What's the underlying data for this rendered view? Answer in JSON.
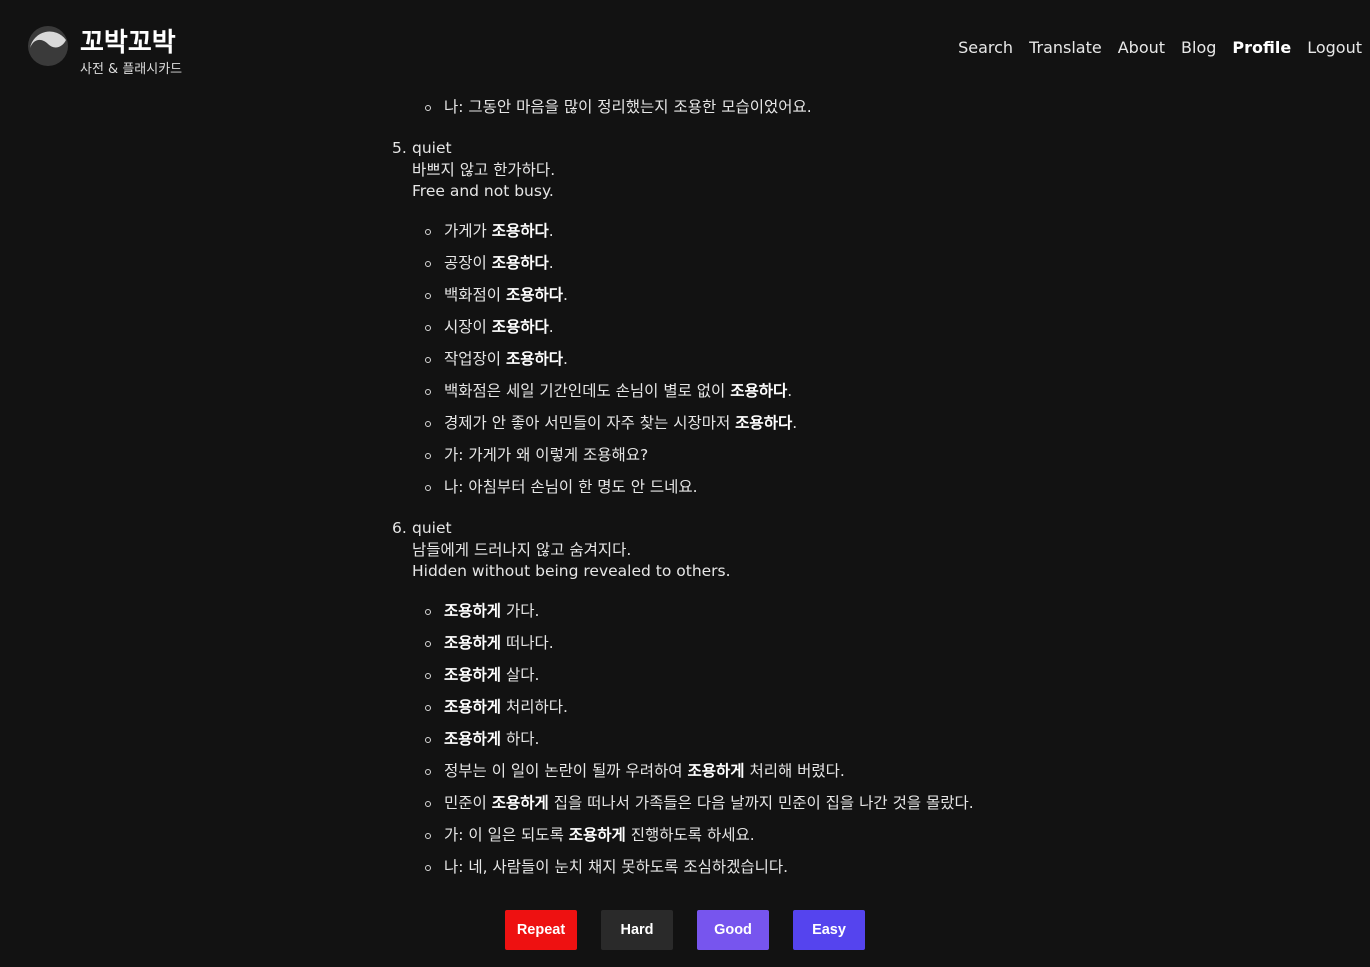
{
  "brand": {
    "title": "꼬박꼬박",
    "subtitle": "사전 & 플래시카드",
    "logo_icon": "yin-yang-logo-icon"
  },
  "nav": [
    {
      "label": "Search"
    },
    {
      "label": "Translate"
    },
    {
      "label": "About"
    },
    {
      "label": "Blog"
    },
    {
      "label": "Profile",
      "active": true
    },
    {
      "label": "Logout"
    }
  ],
  "prev_examples": [
    "나: 그동안 마음을 많이 정리했는지 조용한 모습이었어요."
  ],
  "senses": [
    {
      "number": "5.",
      "word": "quiet",
      "definition_ko": "바쁘지 않고 한가하다.",
      "definition_en": "Free and not busy.",
      "examples": [
        {
          "pre": "가게가 ",
          "bold": "조용하다",
          "post": "."
        },
        {
          "pre": "공장이 ",
          "bold": "조용하다",
          "post": "."
        },
        {
          "pre": "백화점이 ",
          "bold": "조용하다",
          "post": "."
        },
        {
          "pre": "시장이 ",
          "bold": "조용하다",
          "post": "."
        },
        {
          "pre": "작업장이 ",
          "bold": "조용하다",
          "post": "."
        },
        {
          "pre": "백화점은 세일 기간인데도 손님이 별로 없이 ",
          "bold": "조용하다",
          "post": "."
        },
        {
          "pre": "경제가 안 좋아 서민들이 자주 찾는 시장마저 ",
          "bold": "조용하다",
          "post": "."
        },
        {
          "pre": "가: 가게가 왜 이렇게 조용해요?",
          "bold": "",
          "post": ""
        },
        {
          "pre": "나: 아침부터 손님이 한 명도 안 드네요.",
          "bold": "",
          "post": ""
        }
      ]
    },
    {
      "number": "6.",
      "word": "quiet",
      "definition_ko": "남들에게 드러나지 않고 숨겨지다.",
      "definition_en": "Hidden without being revealed to others.",
      "examples": [
        {
          "pre": "",
          "bold": "조용하게",
          "post": " 가다."
        },
        {
          "pre": "",
          "bold": "조용하게",
          "post": " 떠나다."
        },
        {
          "pre": "",
          "bold": "조용하게",
          "post": " 살다."
        },
        {
          "pre": "",
          "bold": "조용하게",
          "post": " 처리하다."
        },
        {
          "pre": "",
          "bold": "조용하게",
          "post": " 하다."
        },
        {
          "pre": "정부는 이 일이 논란이 될까 우려하여 ",
          "bold": "조용하게",
          "post": " 처리해 버렸다."
        },
        {
          "pre": "민준이 ",
          "bold": "조용하게",
          "post": " 집을 떠나서 가족들은 다음 날까지 민준이 집을 나간 것을 몰랐다."
        },
        {
          "pre": "가: 이 일은 되도록 ",
          "bold": "조용하게",
          "post": " 진행하도록 하세요."
        },
        {
          "pre": "나: 네, 사람들이 눈치 채지 못하도록 조심하겠습니다.",
          "bold": "",
          "post": ""
        }
      ]
    }
  ],
  "actions": {
    "repeat": "Repeat",
    "hard": "Hard",
    "good": "Good",
    "easy": "Easy"
  },
  "colors": {
    "background": "#121212",
    "repeat": "#ee1111",
    "hard": "#2a2a2a",
    "good": "#7755ee",
    "easy": "#5544ee"
  }
}
